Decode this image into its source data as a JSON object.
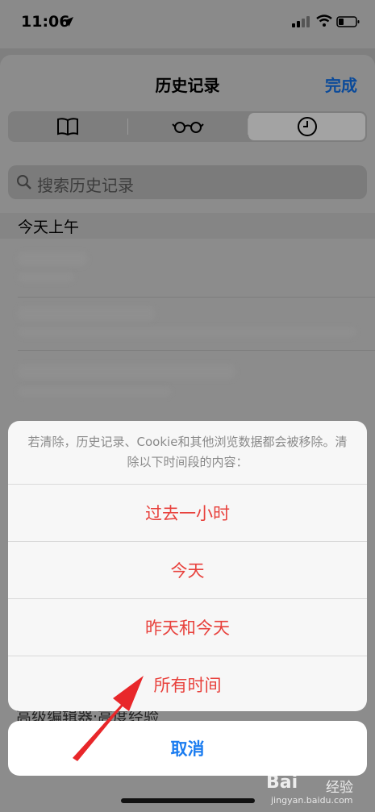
{
  "status_bar": {
    "time": "11:06"
  },
  "sheet": {
    "title": "历史记录",
    "done_label": "完成",
    "tabs": [
      {
        "icon": "book-icon",
        "selected": false
      },
      {
        "icon": "glasses-icon",
        "selected": false
      },
      {
        "icon": "clock-icon",
        "selected": true
      }
    ],
    "search_placeholder": "搜索历史记录",
    "section_header": "今天上午",
    "partial_bottom_text": "高级编辑器·高度经验"
  },
  "action_sheet": {
    "message": "若清除，历史记录、Cookie和其他浏览数据都会被移除。清除以下时间段的内容：",
    "options": [
      "过去一小时",
      "今天",
      "昨天和今天",
      "所有时间"
    ],
    "cancel_label": "取消"
  },
  "watermark": {
    "logo": "Bai",
    "text": "经验",
    "url": "jingyan.baidu.com"
  },
  "colors": {
    "destructive": "#e8413c",
    "accent": "#1a7cf0",
    "arrow": "#e8272a"
  }
}
